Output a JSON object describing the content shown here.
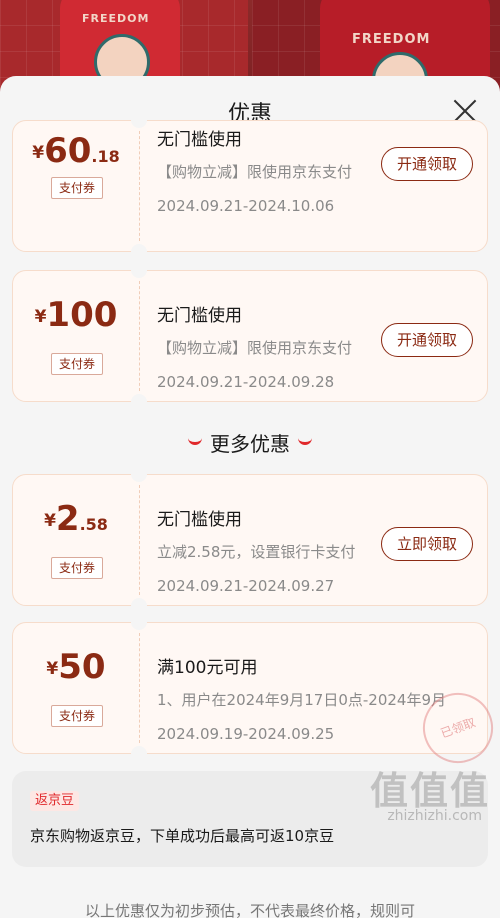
{
  "background": {
    "left_shirt_text": "FREEDOM",
    "right_shirt_text": "FREEDOM"
  },
  "sheet": {
    "title": "优惠"
  },
  "coupons": [
    {
      "yen": "¥",
      "int": "60",
      "dec": ".18",
      "tag": "支付券",
      "title": "无门槛使用",
      "desc": "【购物立减】限使用京东支付",
      "date": "2024.09.21-2024.10.06",
      "button": "开通领取"
    },
    {
      "yen": "¥",
      "int": "100",
      "dec": "",
      "tag": "支付券",
      "title": "无门槛使用",
      "desc": "【购物立减】限使用京东支付",
      "date": "2024.09.21-2024.09.28",
      "button": "开通领取"
    }
  ],
  "more_section": {
    "title": "更多优惠"
  },
  "more_coupons": [
    {
      "yen": "¥",
      "int": "2",
      "dec": ".58",
      "tag": "支付券",
      "title": "无门槛使用",
      "desc": "立减2.58元，设置银行卡支付",
      "date": "2024.09.21-2024.09.27",
      "button": "立即领取"
    },
    {
      "yen": "¥",
      "int": "50",
      "dec": "",
      "tag": "支付券",
      "title": "满100元可用",
      "desc": "1、用户在2024年9月17日0点-2024年9月",
      "date": "2024.09.19-2024.09.25",
      "stamp": "已领取"
    }
  ],
  "rebate": {
    "tag": "返京豆",
    "text": "京东购物返京豆，下单成功后最高可返10京豆"
  },
  "disclaimer": "以上优惠仅为初步预估，不代表最终价格，规则可",
  "watermark": {
    "logo": "值值值",
    "url": "zhizhizhi.com"
  },
  "colors": {
    "accent": "#8b2a13",
    "red": "#e0282b",
    "coupon_bg": "#fff8f4",
    "sheet_bg": "#f5f5f5"
  }
}
